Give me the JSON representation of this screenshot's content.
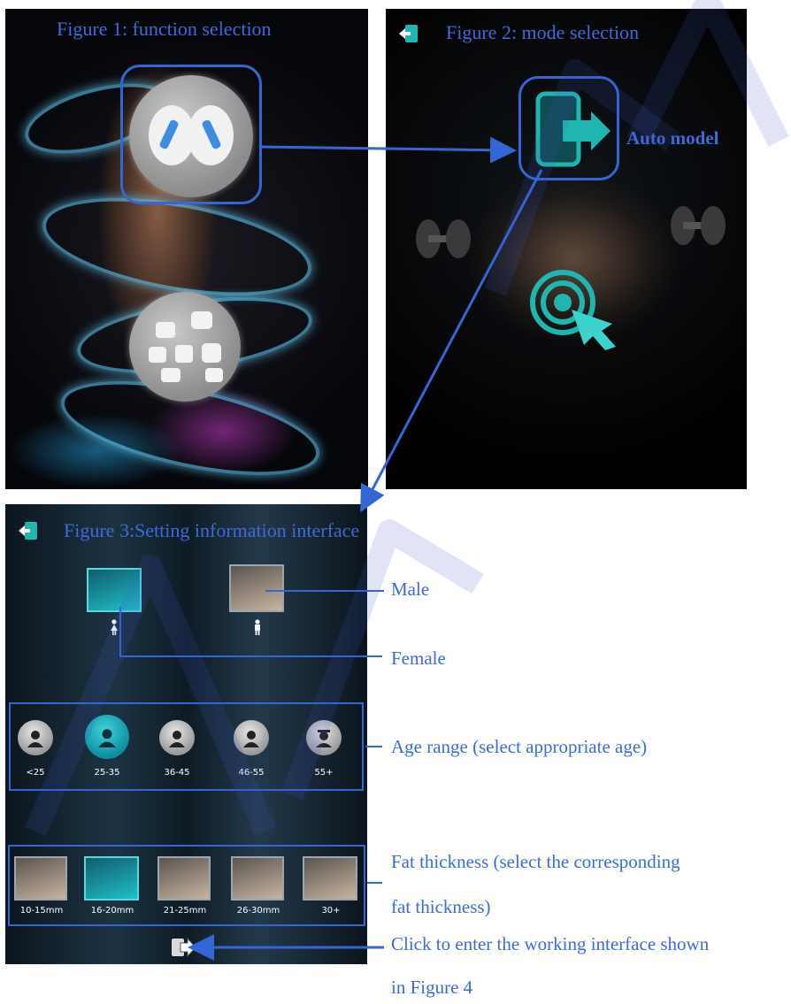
{
  "figure1": {
    "title": "Figure 1: function selection"
  },
  "figure2": {
    "title": "Figure 2: mode selection",
    "auto_label": "Auto model"
  },
  "figure3": {
    "title": "Figure 3:Setting information interface",
    "ages": [
      "<25",
      "25-35",
      "36-45",
      "46-55",
      "55+"
    ],
    "fat": [
      "10-15mm",
      "16-20mm",
      "21-25mm",
      "26-30mm",
      "30+"
    ]
  },
  "annotations": {
    "male": "Male",
    "female": "Female",
    "age_range": "Age range (select appropriate age)",
    "fat_line1": "Fat thickness (select the corresponding",
    "fat_line2": "fat thickness)",
    "click_line1": "Click to enter the working interface shown",
    "click_line2": "in Figure 4"
  },
  "watermark": "MIA FRESH ROBUVA",
  "colors": {
    "annotation_blue": "#3d6bd7",
    "teal_selected": "#1fc0c8"
  }
}
